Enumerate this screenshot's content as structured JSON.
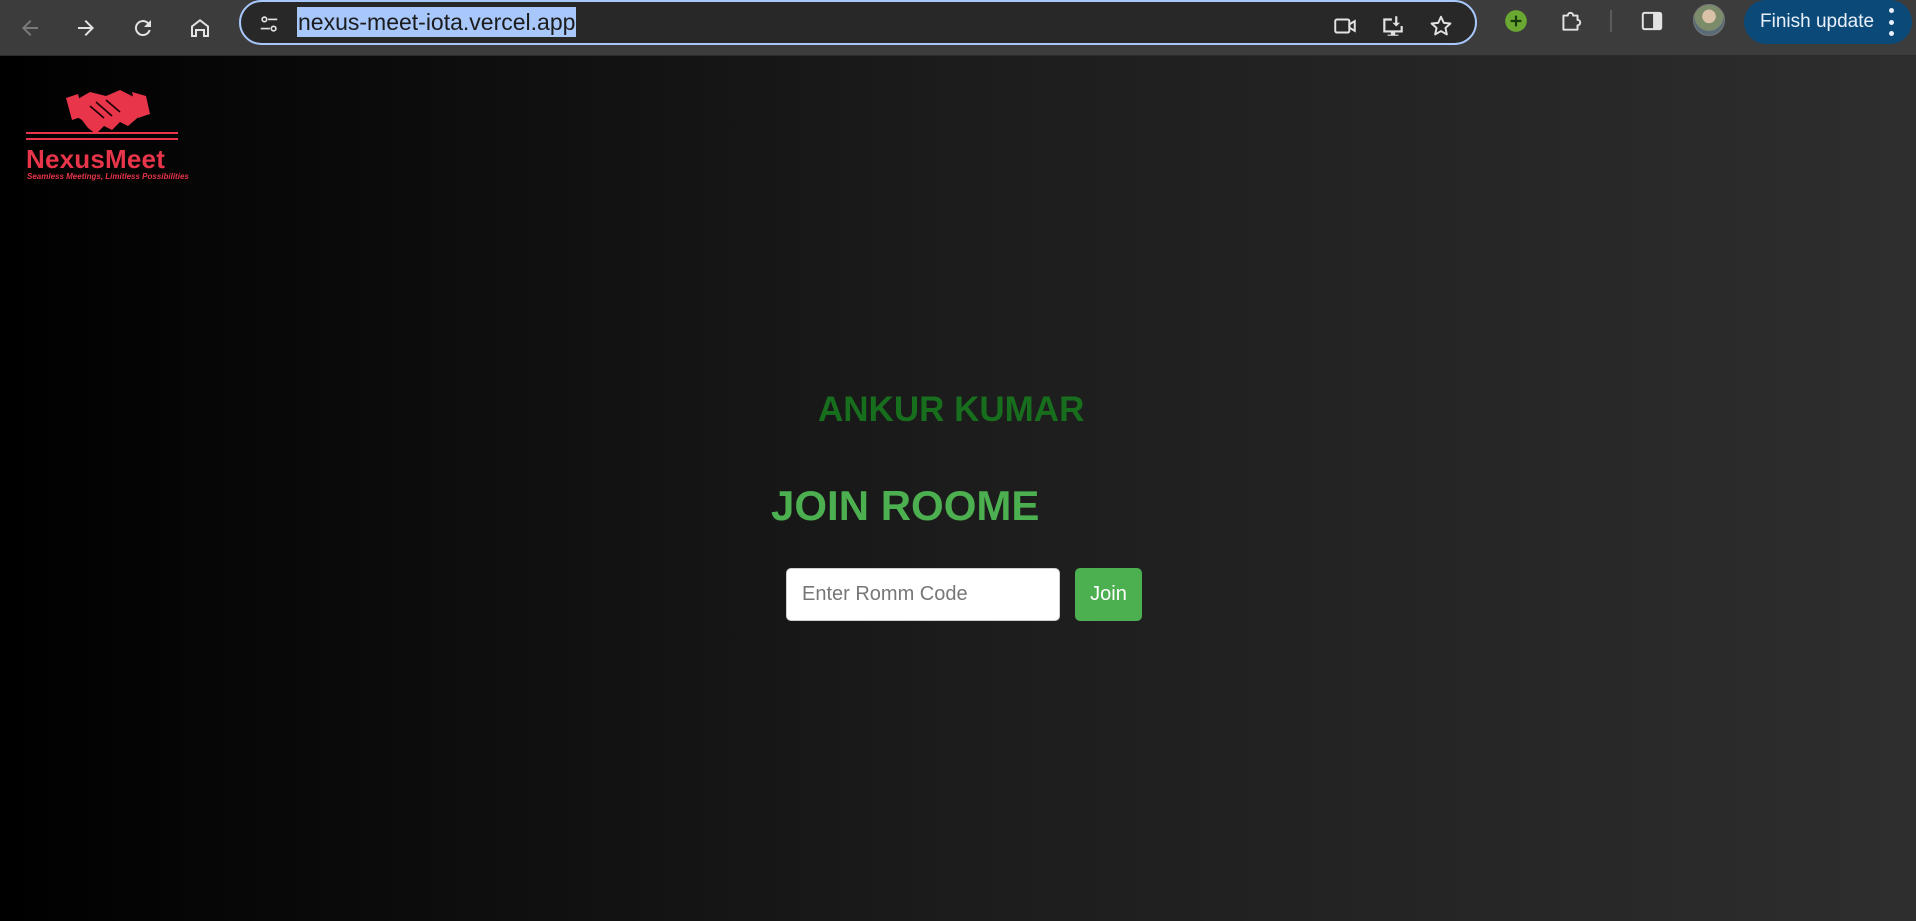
{
  "browser": {
    "url": "nexus-meet-iota.vercel.app",
    "finish_update_label": "Finish update",
    "icons": {
      "back": "arrow-back-icon",
      "forward": "arrow-forward-icon",
      "reload": "reload-icon",
      "home": "home-icon",
      "site_info": "tune-icon",
      "camera": "video-camera-icon",
      "install": "install-app-icon",
      "bookmark": "star-icon",
      "extension_green": "plus-circle-icon",
      "extensions": "puzzle-icon",
      "side_panel": "side-panel-icon",
      "profile": "avatar",
      "menu": "more-vert-icon"
    },
    "colors": {
      "accent": "#a8c7fa",
      "update_button": "#0b4a78"
    }
  },
  "logo": {
    "name": "NexusMeet",
    "tagline": "Seamless Meetings, Limitless Possibilities",
    "color": "#e8354a"
  },
  "main": {
    "user_name": "ANKUR KUMAR",
    "heading": "JOIN ROOME",
    "room_input_placeholder": "Enter Romm Code",
    "room_input_value": "",
    "join_label": "Join"
  },
  "colors": {
    "user_name": "#176e1c",
    "heading": "#4caf50",
    "join_button": "#4caf50"
  }
}
